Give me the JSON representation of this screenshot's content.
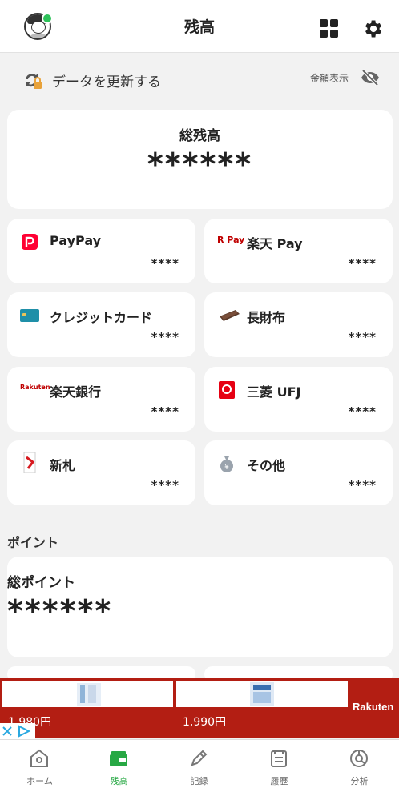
{
  "header": {
    "title": "残高"
  },
  "refresh": {
    "label": "データを更新する",
    "amount_toggle_label": "金額表示"
  },
  "total": {
    "title": "総残高",
    "value": "******"
  },
  "wallets": [
    {
      "name": "PayPay",
      "amount": "****",
      "icon": "paypay-icon"
    },
    {
      "name": "楽天 Pay",
      "amount": "****",
      "icon": "rakuten-pay-icon",
      "icon_text": "R Pay"
    },
    {
      "name": "クレジットカード",
      "amount": "****",
      "icon": "credit-card-icon"
    },
    {
      "name": "長財布",
      "amount": "****",
      "icon": "long-wallet-icon"
    },
    {
      "name": "楽天銀行",
      "amount": "****",
      "icon": "rakuten-bank-icon",
      "icon_text": "Rakuten"
    },
    {
      "name": "三菱 UFJ",
      "amount": "****",
      "icon": "mufg-icon"
    },
    {
      "name": "新札",
      "amount": "****",
      "icon": "new-bill-icon"
    },
    {
      "name": "その他",
      "amount": "****",
      "icon": "money-bag-icon"
    }
  ],
  "points": {
    "section_label": "ポイント",
    "title": "総ポイント",
    "value": "******"
  },
  "ad": {
    "items": [
      {
        "price": "1,980円"
      },
      {
        "price": "1,990円"
      }
    ],
    "brand": "Rakuten"
  },
  "tabs": [
    {
      "label": "ホーム",
      "icon": "home-icon"
    },
    {
      "label": "残高",
      "icon": "wallet-icon",
      "active": true
    },
    {
      "label": "記録",
      "icon": "pencil-icon"
    },
    {
      "label": "履歴",
      "icon": "list-icon"
    },
    {
      "label": "分析",
      "icon": "chart-icon"
    }
  ],
  "colors": {
    "accent": "#27a844",
    "background": "#f2f2f2",
    "ad_background": "#b31e13"
  }
}
